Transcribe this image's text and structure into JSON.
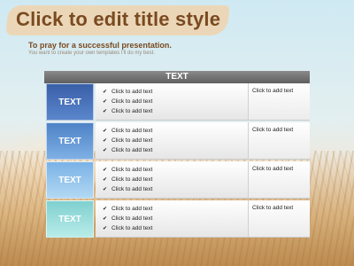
{
  "title": "Click to edit title style",
  "subtitle": "To pray  for  a successful presentation.",
  "subtext": "You want to create your own templates I'll do my best.",
  "table": {
    "header": "TEXT",
    "check_icon": "checkmark-icon",
    "rows": [
      {
        "label": "TEXT",
        "label_color": "#3f68b2",
        "items": [
          "Click to add text",
          "Click to add text",
          "Click to add text"
        ],
        "right": "Click to add text"
      },
      {
        "label": "TEXT",
        "label_color": "#5f94d4",
        "items": [
          "Click to add text",
          "Click to add text",
          "Click to add text"
        ],
        "right": "Click to add text"
      },
      {
        "label": "TEXT",
        "label_color": "#8ec0ea",
        "items": [
          "Click to add text",
          "Click to add text",
          "Click to add text"
        ],
        "right": "Click to add text"
      },
      {
        "label": "TEXT",
        "label_color": "#8fd7d6",
        "items": [
          "Click to add text",
          "Click to add text",
          "Click to add text"
        ],
        "right": "Click to add text"
      }
    ]
  },
  "colors": {
    "title": "#7a4a20",
    "header": "#6f6f6f"
  }
}
